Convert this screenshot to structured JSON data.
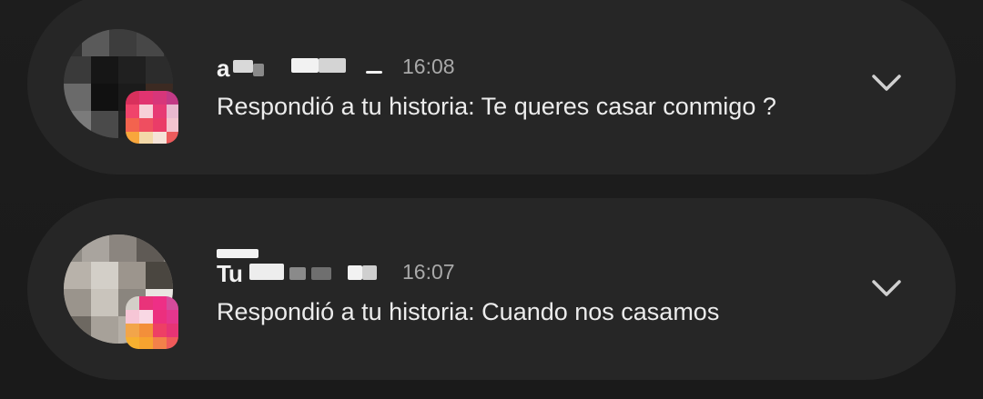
{
  "notifications": [
    {
      "sender": "a",
      "time": "16:08",
      "message": "Respondió a tu historia: Te queres casar conmigo ?",
      "expand_icon": "chevron-down-icon",
      "avatar_icon": "blurred-profile-photo",
      "app_icon": "instagram-icon"
    },
    {
      "sender": "Tu",
      "time": "16:07",
      "message": "Respondió a tu historia: Cuando nos casamos",
      "expand_icon": "chevron-down-icon",
      "avatar_icon": "blurred-profile-photo",
      "app_icon": "instagram-icon"
    }
  ],
  "colors": {
    "background": "#1c1c1c",
    "card": "#262626",
    "text_primary": "#ececec",
    "text_secondary": "#a9a9a9",
    "instagram_gradient": [
      "#f77737",
      "#e1306c",
      "#c13584"
    ]
  }
}
